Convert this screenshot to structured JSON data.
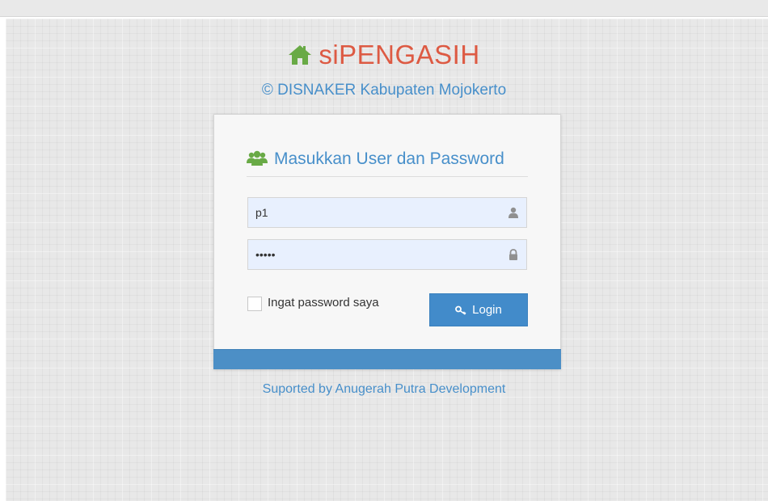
{
  "app": {
    "title": "siPENGASIH",
    "subtitle": "© DISNAKER Kabupaten Mojokerto",
    "title_icon": "home-icon",
    "colors": {
      "brand": "#dd5a43",
      "accent": "#478fca",
      "button": "#428bca"
    }
  },
  "login": {
    "header": "Masukkan User dan Password",
    "header_icon": "users-icon",
    "username": {
      "value": "p1",
      "icon": "user-icon"
    },
    "password": {
      "value": "12345",
      "icon": "lock-icon"
    },
    "remember_label": "Ingat password saya",
    "remember_checked": false,
    "button_label": "Login",
    "button_icon": "key-icon"
  },
  "footer": {
    "supported_text": "Suported by Anugerah Putra Development"
  }
}
